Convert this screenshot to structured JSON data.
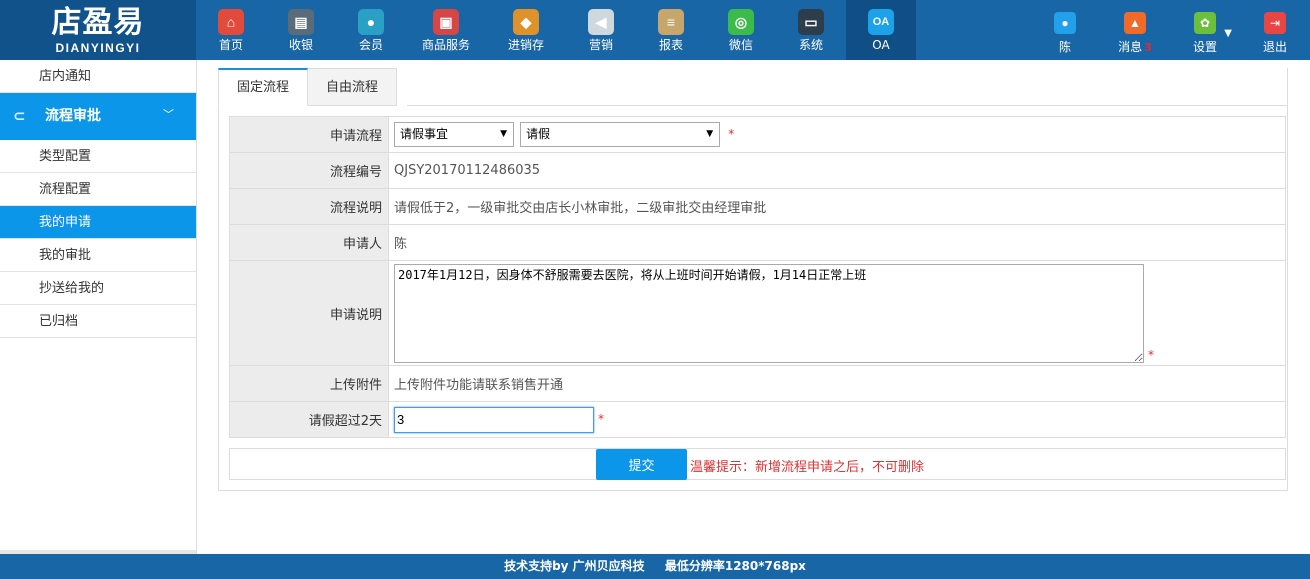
{
  "logo": {
    "cn": "店盈易",
    "en": "DIANYINGYI"
  },
  "nav": [
    {
      "label": "首页",
      "icon": "home-icon",
      "color": "#e24a3b",
      "glyph": "⌂"
    },
    {
      "label": "收银",
      "icon": "cash-register-icon",
      "color": "#5a6b7a",
      "glyph": "▤"
    },
    {
      "label": "会员",
      "icon": "member-icon",
      "color": "#2aa0c7",
      "glyph": "●"
    },
    {
      "label": "商品服务",
      "icon": "goods-service-icon",
      "color": "#d84545",
      "glyph": "▣"
    },
    {
      "label": "进销存",
      "icon": "inventory-icon",
      "color": "#e0922a",
      "glyph": "◆"
    },
    {
      "label": "营销",
      "icon": "marketing-icon",
      "color": "#cfd8df",
      "glyph": "◀"
    },
    {
      "label": "报表",
      "icon": "report-icon",
      "color": "#c7a66b",
      "glyph": "≡"
    },
    {
      "label": "微信",
      "icon": "wechat-icon",
      "color": "#3dbb4a",
      "glyph": "◎"
    },
    {
      "label": "系统",
      "icon": "system-icon",
      "color": "#2e3d4b",
      "glyph": "▭"
    },
    {
      "label": "OA",
      "icon": "oa-icon",
      "color": "#1ba2e8",
      "glyph": "OA"
    }
  ],
  "right_nav": [
    {
      "label": "陈",
      "icon": "user-icon",
      "color": "#22a0ea",
      "glyph": "●"
    },
    {
      "label": "消息",
      "badge": "3",
      "icon": "bell-icon",
      "color": "#f06a2a",
      "glyph": "▲"
    },
    {
      "label": "设置",
      "icon": "settings-icon",
      "color": "#6bbf3a",
      "glyph": "✿"
    },
    {
      "label": "退出",
      "icon": "logout-icon",
      "color": "#e84545",
      "glyph": "⇥"
    }
  ],
  "sidebar": {
    "top_item": "店内通知",
    "group": "流程审批",
    "items": [
      "类型配置",
      "流程配置",
      "我的申请",
      "我的审批",
      "抄送给我的",
      "已归档"
    ]
  },
  "tabs": [
    "固定流程",
    "自由流程"
  ],
  "form": {
    "flow_label": "申请流程",
    "flow_select1": "请假事宜",
    "flow_select2": "请假",
    "req": "*",
    "number_label": "流程编号",
    "number_value": "QJSY20170112486035",
    "desc_label": "流程说明",
    "desc_value": "请假低于2，一级审批交由店长小林审批，二级审批交由经理审批",
    "applicant_label": "申请人",
    "applicant_value": "陈",
    "note_label": "申请说明",
    "note_value": "2017年1月12日，因身体不舒服需要去医院，将从上班时间开始请假，1月14日正常上班",
    "attach_label": "上传附件",
    "attach_value": "上传附件功能请联系销售开通",
    "days_label": "请假超过2天",
    "days_value": "3"
  },
  "submit": {
    "label": "提交",
    "tip": "温馨提示：新增流程申请之后，不可删除"
  },
  "footer": {
    "support": "技术支持by 广州贝应科技",
    "resolution": "最低分辨率1280*768px"
  }
}
